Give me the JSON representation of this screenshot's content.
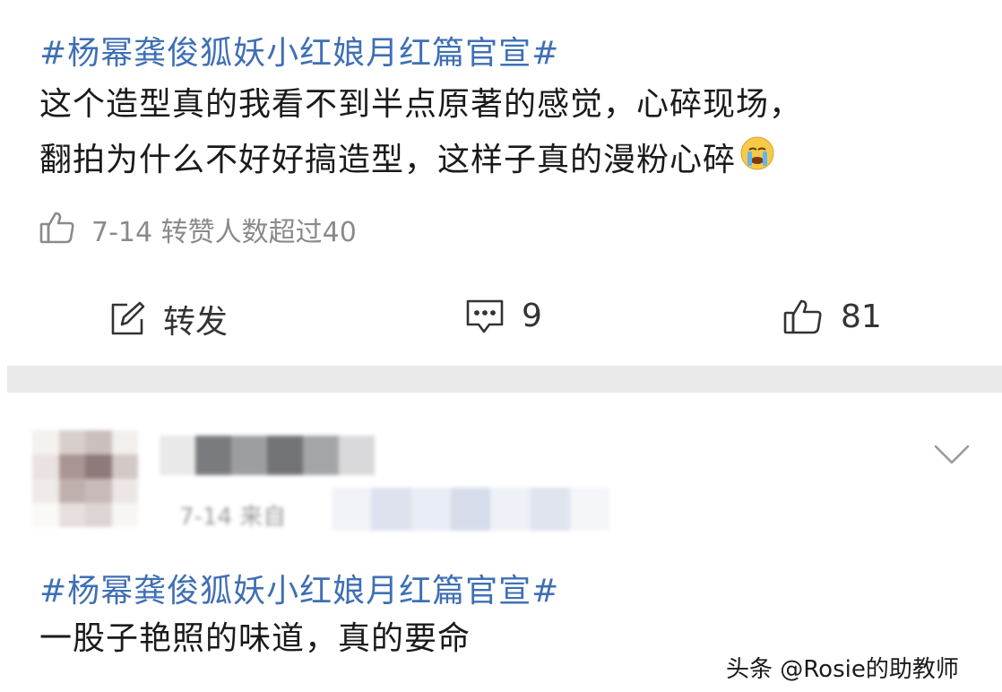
{
  "post": {
    "hashtag": "#杨幂龚俊狐妖小红娘月红篇官宣#",
    "lines": [
      "这个造型真的我看不到半点原著的感觉，心碎现场，",
      "翻拍为什么不好好搞造型，这样子真的漫粉心碎"
    ],
    "emoji_icon": "crying-face-icon",
    "meta": "7-14 转赞人数超过40",
    "actions": {
      "repost_label": "转发",
      "comment_count": "9",
      "like_count": "81"
    }
  },
  "comment": {
    "date_fragment": "7-14 来自",
    "hashtag": "#杨幂龚俊狐妖小红娘月红篇官宣#",
    "text": "一股子艳照的味道，真的要命"
  },
  "watermark": "头条 @Rosie的助教师"
}
